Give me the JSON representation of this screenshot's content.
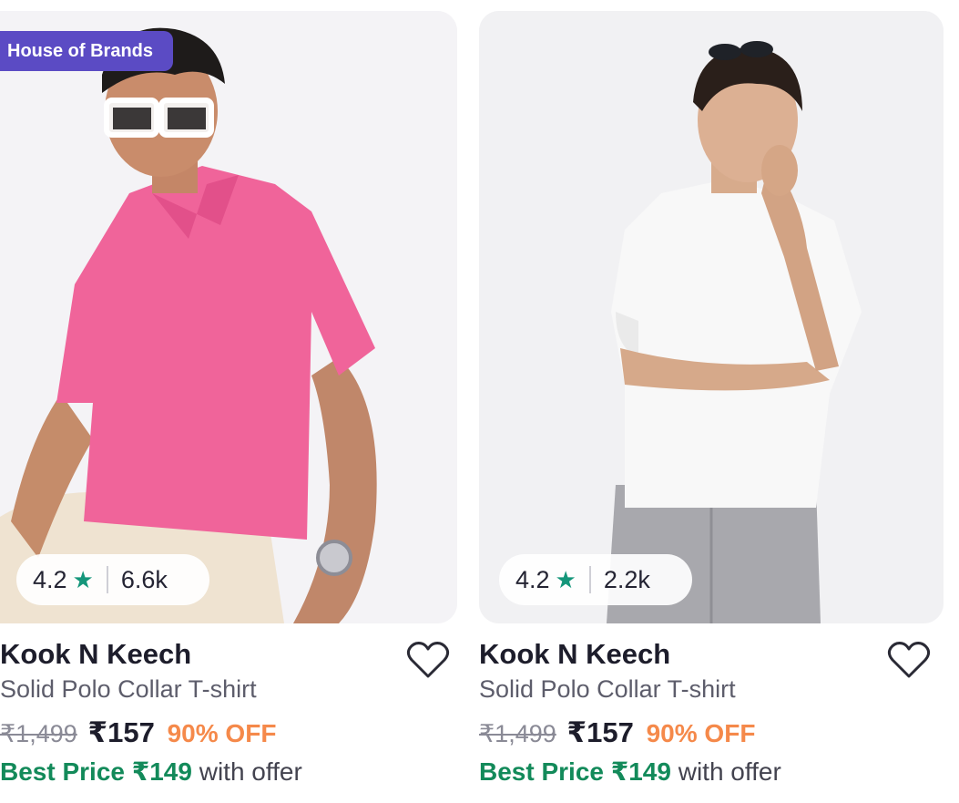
{
  "products": [
    {
      "badge": "House of Brands",
      "rating": "4.2",
      "rating_count": "6.6k",
      "brand": "Kook N Keech",
      "title": "Solid Polo Collar T-shirt",
      "mrp": "₹1,499",
      "price": "₹157",
      "discount": "90% OFF",
      "best_price": "Best Price ₹149",
      "best_price_suffix": " with offer",
      "shirt_color": "#f0649a"
    },
    {
      "rating": "4.2",
      "rating_count": "2.2k",
      "brand": "Kook N Keech",
      "title": "Solid Polo Collar T-shirt",
      "mrp": "₹1,499",
      "price": "₹157",
      "discount": "90% OFF",
      "best_price": "Best Price ₹149",
      "best_price_suffix": " with offer",
      "shirt_color": "#f7f7f7"
    }
  ],
  "icons": {
    "rating": "star-icon",
    "wishlist": "heart-outline-icon"
  },
  "colors": {
    "badge_bg": "#5b4bc4",
    "rating_star": "#14967a",
    "discount": "#f5894a",
    "best_price": "#138a5a"
  }
}
